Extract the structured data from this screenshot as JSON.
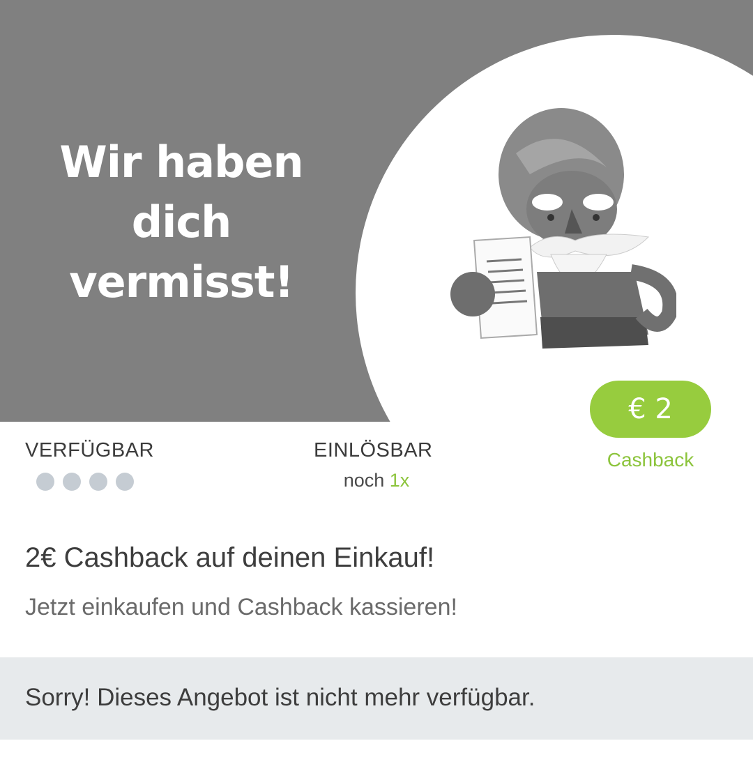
{
  "hero": {
    "title_lines": [
      "Wir haben",
      "dich",
      "vermisst!"
    ],
    "illustration_icon": "mascot-with-receipt-illustration"
  },
  "badge": {
    "amount": "€ 2",
    "caption": "Cashback",
    "color": "#97cc3e"
  },
  "availability": {
    "label": "VERFÜGBAR",
    "dot_count": 4
  },
  "redeemable": {
    "label": "EINLÖSBAR",
    "prefix": "noch",
    "count": "1x"
  },
  "offer": {
    "title": "2€ Cashback auf deinen Einkauf!",
    "subtitle": "Jetzt einkaufen und Cashback kassieren!"
  },
  "notice": {
    "text": "Sorry! Dieses Angebot ist nicht mehr verfügbar."
  },
  "colors": {
    "accent_green": "#8cc43c",
    "hero_background": "#808080",
    "notice_background": "#e7eaec"
  }
}
